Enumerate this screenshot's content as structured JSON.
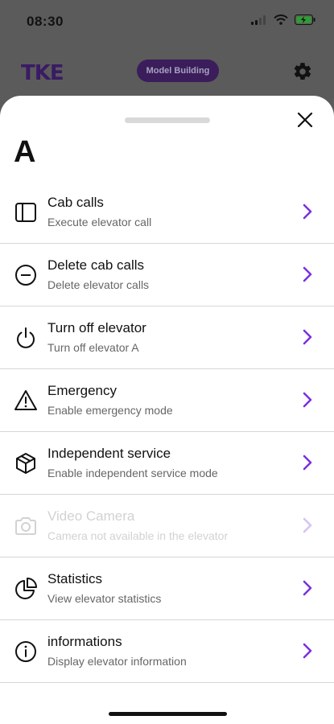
{
  "status": {
    "time": "08:30",
    "signal_icon": "cellular-signal-icon",
    "wifi_icon": "wifi-icon",
    "battery_icon": "battery-charging-icon"
  },
  "appbar": {
    "logo": "TKE",
    "building": "Model Building",
    "settings_icon": "gear-icon"
  },
  "sheet": {
    "title": "A",
    "close_icon": "close-icon",
    "items": [
      {
        "label": "Cab calls",
        "subtitle": "Execute elevator call",
        "icon": "panel-icon",
        "enabled": true
      },
      {
        "label": "Delete cab calls",
        "subtitle": "Delete elevator calls",
        "icon": "minus-circle-icon",
        "enabled": true
      },
      {
        "label": "Turn off elevator",
        "subtitle": "Turn off elevator A",
        "icon": "power-icon",
        "enabled": true
      },
      {
        "label": "Emergency",
        "subtitle": "Enable emergency mode",
        "icon": "warning-icon",
        "enabled": true
      },
      {
        "label": "Independent service",
        "subtitle": "Enable independent service mode",
        "icon": "cube-icon",
        "enabled": true
      },
      {
        "label": "Video Camera",
        "subtitle": "Camera not available in the elevator",
        "icon": "camera-icon",
        "enabled": false
      },
      {
        "label": "Statistics",
        "subtitle": "View elevator statistics",
        "icon": "pie-chart-icon",
        "enabled": true
      },
      {
        "label": "informations",
        "subtitle": "Display elevator information",
        "icon": "info-icon",
        "enabled": true
      }
    ]
  },
  "colors": {
    "accent": "#7b2fe0",
    "accent_disabled": "#d6c2f5",
    "overlay": "#5b5b5b",
    "text": "#111111",
    "subtext": "#666666"
  }
}
